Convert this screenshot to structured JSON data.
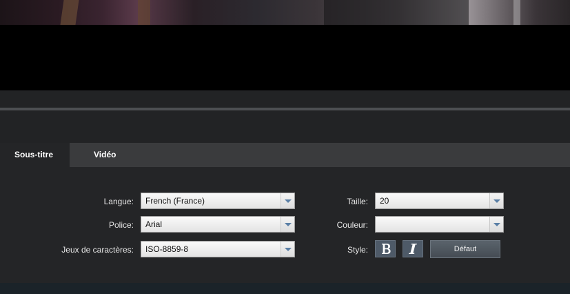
{
  "tabs": [
    {
      "label": "Sous-titre",
      "active": true
    },
    {
      "label": "Vidéo",
      "active": false
    }
  ],
  "subtitle_settings": {
    "language": {
      "label": "Langue:",
      "value": "French (France)"
    },
    "font": {
      "label": "Police:",
      "value": "Arial"
    },
    "charset": {
      "label": "Jeux de caractères:",
      "value": "ISO-8859-8"
    },
    "size": {
      "label": "Taille:",
      "value": "20"
    },
    "color": {
      "label": "Couleur:",
      "value": ""
    },
    "style": {
      "label": "Style:",
      "bold_icon": "bold-icon",
      "italic_icon": "italic-icon"
    },
    "default_button": "Défaut"
  },
  "colors": {
    "panel_bg": "#242527",
    "tab_bar_bg": "#3a3b3d",
    "dropdown_arrow": "#5a7fa6",
    "style_button_bg": "#4e5a68"
  }
}
